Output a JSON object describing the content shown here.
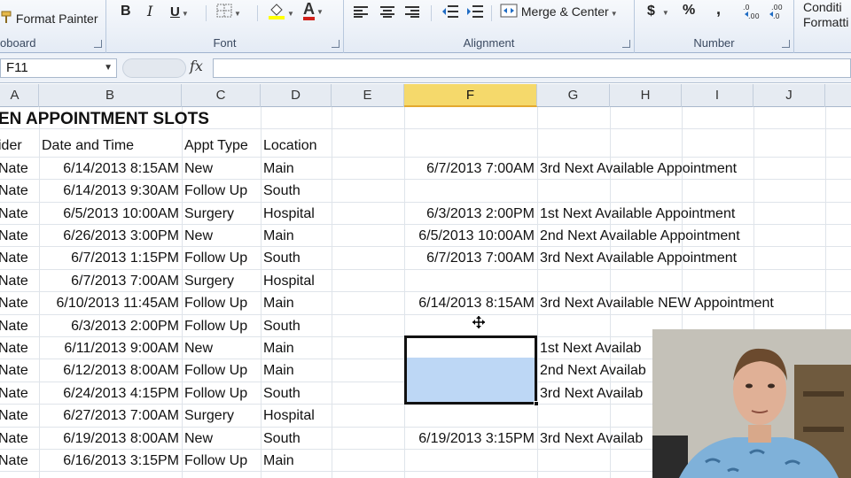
{
  "ribbon": {
    "clipboard": {
      "format_painter": "Format Painter",
      "label": "oboard"
    },
    "font": {
      "bold": "B",
      "italic": "I",
      "underline": "U",
      "font_color_glyph": "A",
      "label": "Font"
    },
    "alignment": {
      "merge_center": "Merge & Center",
      "label": "Alignment"
    },
    "number": {
      "currency": "$",
      "percent": "%",
      "comma": ",",
      "label": "Number"
    },
    "styles": {
      "conditional_line1": "Conditi",
      "conditional_line2": "Formatti"
    }
  },
  "formula_bar": {
    "name_box": "F11",
    "fx": "fx",
    "value": ""
  },
  "columns": [
    {
      "label": "A"
    },
    {
      "label": "B"
    },
    {
      "label": "C"
    },
    {
      "label": "D"
    },
    {
      "label": "E"
    },
    {
      "label": "F",
      "selected": true
    },
    {
      "label": "G"
    },
    {
      "label": "H"
    },
    {
      "label": "I"
    },
    {
      "label": "J"
    }
  ],
  "sheet": {
    "title": "EN APPOINTMENT SLOTS",
    "headers": {
      "a": "ider",
      "b": "Date and Time",
      "c": "Appt Type",
      "d": "Location"
    },
    "rows": [
      {
        "a": "Nate",
        "b": "6/14/2013 8:15AM",
        "c": "New",
        "d": "Main",
        "f": "6/7/2013 7:00AM",
        "g": "3rd Next Available Appointment"
      },
      {
        "a": "Nate",
        "b": "6/14/2013 9:30AM",
        "c": "Follow Up",
        "d": "South",
        "f": "",
        "g": ""
      },
      {
        "a": "Nate",
        "b": "6/5/2013 10:00AM",
        "c": "Surgery",
        "d": "Hospital",
        "f": "6/3/2013 2:00PM",
        "g": "1st Next Available Appointment"
      },
      {
        "a": "Nate",
        "b": "6/26/2013 3:00PM",
        "c": "New",
        "d": "Main",
        "f": "6/5/2013 10:00AM",
        "g": "2nd Next Available Appointment"
      },
      {
        "a": "Nate",
        "b": "6/7/2013 1:15PM",
        "c": "Follow Up",
        "d": "South",
        "f": "6/7/2013 7:00AM",
        "g": "3rd Next Available Appointment"
      },
      {
        "a": "Nate",
        "b": "6/7/2013 7:00AM",
        "c": "Surgery",
        "d": "Hospital",
        "f": "",
        "g": ""
      },
      {
        "a": "Nate",
        "b": "6/10/2013 11:45AM",
        "c": "Follow Up",
        "d": "Main",
        "f": "6/14/2013 8:15AM",
        "g": "3rd Next Available NEW Appointment"
      },
      {
        "a": "Nate",
        "b": "6/3/2013 2:00PM",
        "c": "Follow Up",
        "d": "South",
        "f": "",
        "g": ""
      },
      {
        "a": "Nate",
        "b": "6/11/2013 9:00AM",
        "c": "New",
        "d": "Main",
        "f": "",
        "g": "1st Next Availab"
      },
      {
        "a": "Nate",
        "b": "6/12/2013 8:00AM",
        "c": "Follow Up",
        "d": "Main",
        "f": "",
        "g": "2nd Next Availab"
      },
      {
        "a": "Nate",
        "b": "6/24/2013 4:15PM",
        "c": "Follow Up",
        "d": "South",
        "f": "",
        "g": "3rd Next Availab"
      },
      {
        "a": "Nate",
        "b": "6/27/2013 7:00AM",
        "c": "Surgery",
        "d": "Hospital",
        "f": "",
        "g": ""
      },
      {
        "a": "Nate",
        "b": "6/19/2013 8:00AM",
        "c": "New",
        "d": "South",
        "f": "6/19/2013 3:15PM",
        "g": "3rd Next Availab"
      },
      {
        "a": "Nate",
        "b": "6/16/2013 3:15PM",
        "c": "Follow Up",
        "d": "Main",
        "f": "",
        "g": ""
      }
    ]
  },
  "colors": {
    "accent_selected_col": "#f5d96b",
    "selection_fill": "#bdd7f5"
  }
}
